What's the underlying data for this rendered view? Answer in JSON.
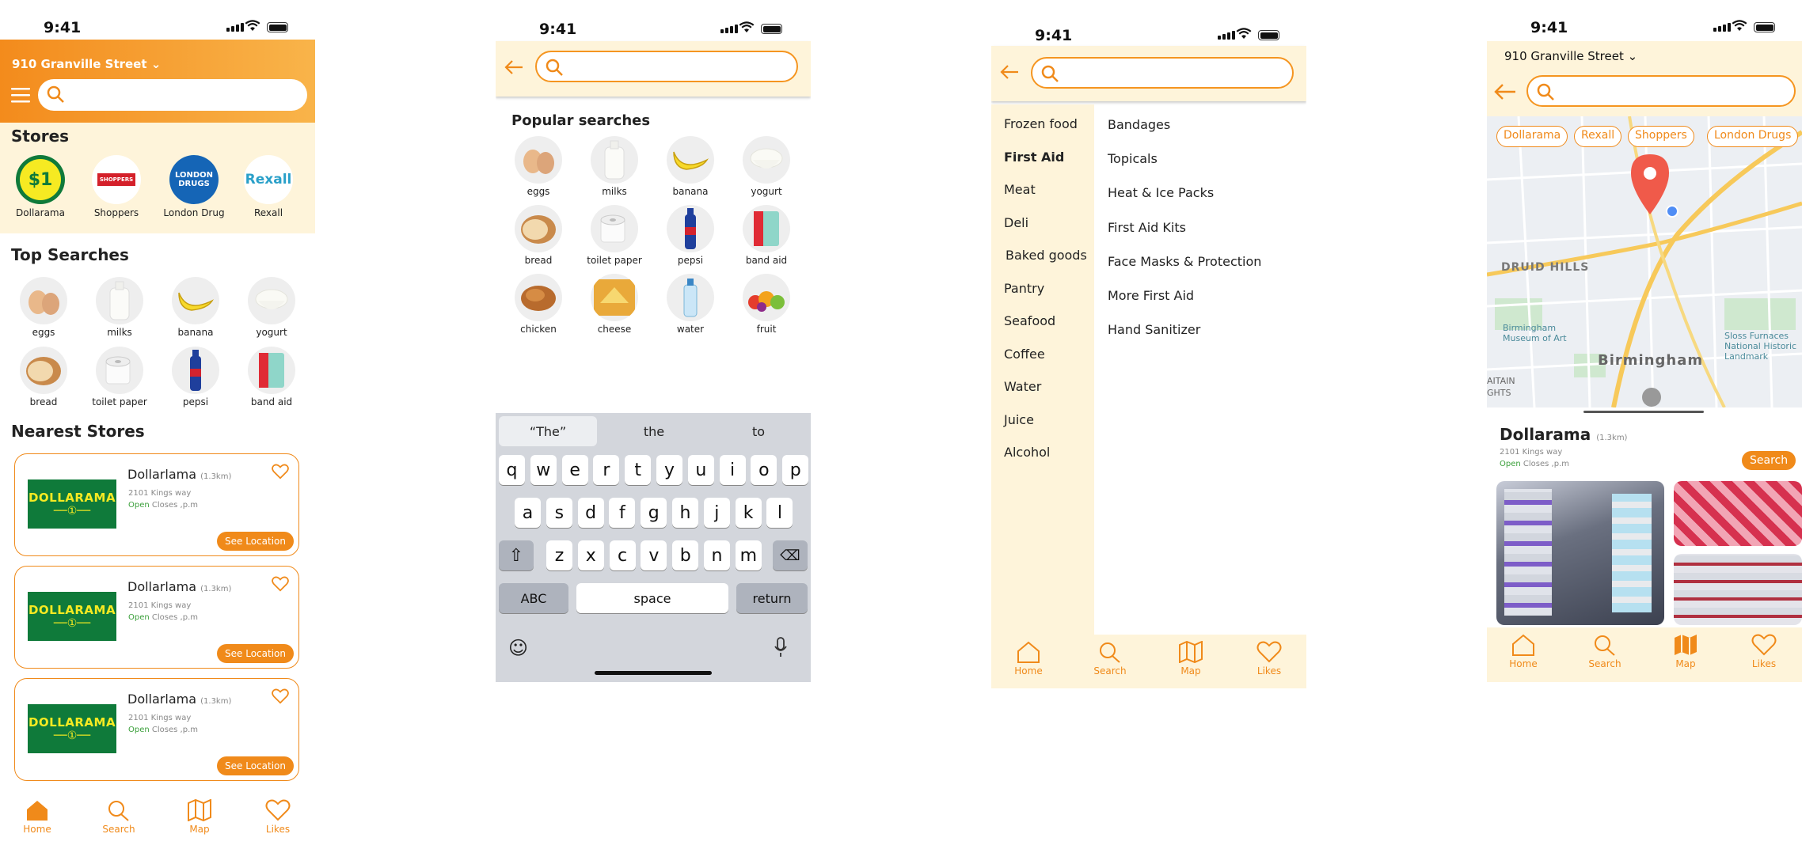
{
  "status": {
    "time": "9:41"
  },
  "home": {
    "address": "910 Granville Street",
    "stores_title": "Stores",
    "stores": [
      {
        "name": "Dollarama",
        "logo": "$1"
      },
      {
        "name": "Shoppers",
        "logo": "SHOPPERS"
      },
      {
        "name": "London Drug",
        "logo": "LONDON DRUGS"
      },
      {
        "name": "Rexall",
        "logo": "Rexall"
      }
    ],
    "top_searches_title": "Top Searches",
    "items": [
      "eggs",
      "milks",
      "banana",
      "yogurt",
      "bread",
      "toilet paper",
      "pepsi",
      "band aid"
    ],
    "nearest_title": "Nearest Stores",
    "nearest": [
      {
        "logo": "DOLLARAMA",
        "name": "Dollarlama",
        "distance": "(1.3km)",
        "address": "2101 Kings way",
        "open": "Open",
        "closes": "Closes ,p.m",
        "button": "See Location"
      },
      {
        "logo": "DOLLARAMA",
        "name": "Dollarlama",
        "distance": "(1.3km)",
        "address": "2101 Kings way",
        "open": "Open",
        "closes": "Closes ,p.m",
        "button": "See Location"
      },
      {
        "logo": "DOLLARAMA",
        "name": "Dollarlama",
        "distance": "(1.3km)",
        "address": "2101 Kings way",
        "open": "Open",
        "closes": "Closes ,p.m",
        "button": "See Location"
      }
    ]
  },
  "tabs": [
    "Home",
    "Search",
    "Map",
    "Likes"
  ],
  "search": {
    "popular_title": "Popular searches",
    "items": [
      "eggs",
      "milks",
      "banana",
      "yogurt",
      "bread",
      "toilet paper",
      "pepsi",
      "band aid",
      "chicken",
      "cheese",
      "water",
      "fruit"
    ],
    "keyboard": {
      "suggestions": [
        "“The”",
        "the",
        "to"
      ],
      "row1": [
        "q",
        "w",
        "e",
        "r",
        "t",
        "y",
        "u",
        "i",
        "o",
        "p"
      ],
      "row2": [
        "a",
        "s",
        "d",
        "f",
        "g",
        "h",
        "j",
        "k",
        "l"
      ],
      "row3": [
        "z",
        "x",
        "c",
        "v",
        "b",
        "n",
        "m"
      ],
      "abc": "ABC",
      "space": "space",
      "return": "return"
    }
  },
  "categories": {
    "left": [
      "Frozen food",
      "First Aid",
      "Meat",
      "Deli",
      "Baked goods",
      "Pantry",
      "Seafood",
      "Coffee",
      "Water",
      "Juice",
      "Alcohol"
    ],
    "selected": "First Aid",
    "right": [
      "Bandages",
      "Topicals",
      "Heat & Ice Packs",
      "First Aid Kits",
      "Face Masks & Protection",
      "More First Aid",
      "Hand Sanitizer"
    ]
  },
  "map": {
    "address": "910 Granville Street",
    "chips": [
      "Dollarama",
      "Rexall",
      "Shoppers",
      "London Drugs"
    ],
    "labels": [
      "DRUID HILLS",
      "Birmingham",
      "Birmingham Museum of Art",
      "Sloss Furnaces National Historic Landmark",
      "AITAIN",
      "GHTS"
    ],
    "store_name": "Dollarama",
    "distance": "(1.3km)",
    "address_line": "2101 Kings way",
    "open": "Open",
    "closes": "Closes ,p.m",
    "search_button": "Search"
  },
  "colors": {
    "accent": "#f08a1a",
    "cream": "#fef4da",
    "green": "#0f7a3a"
  }
}
